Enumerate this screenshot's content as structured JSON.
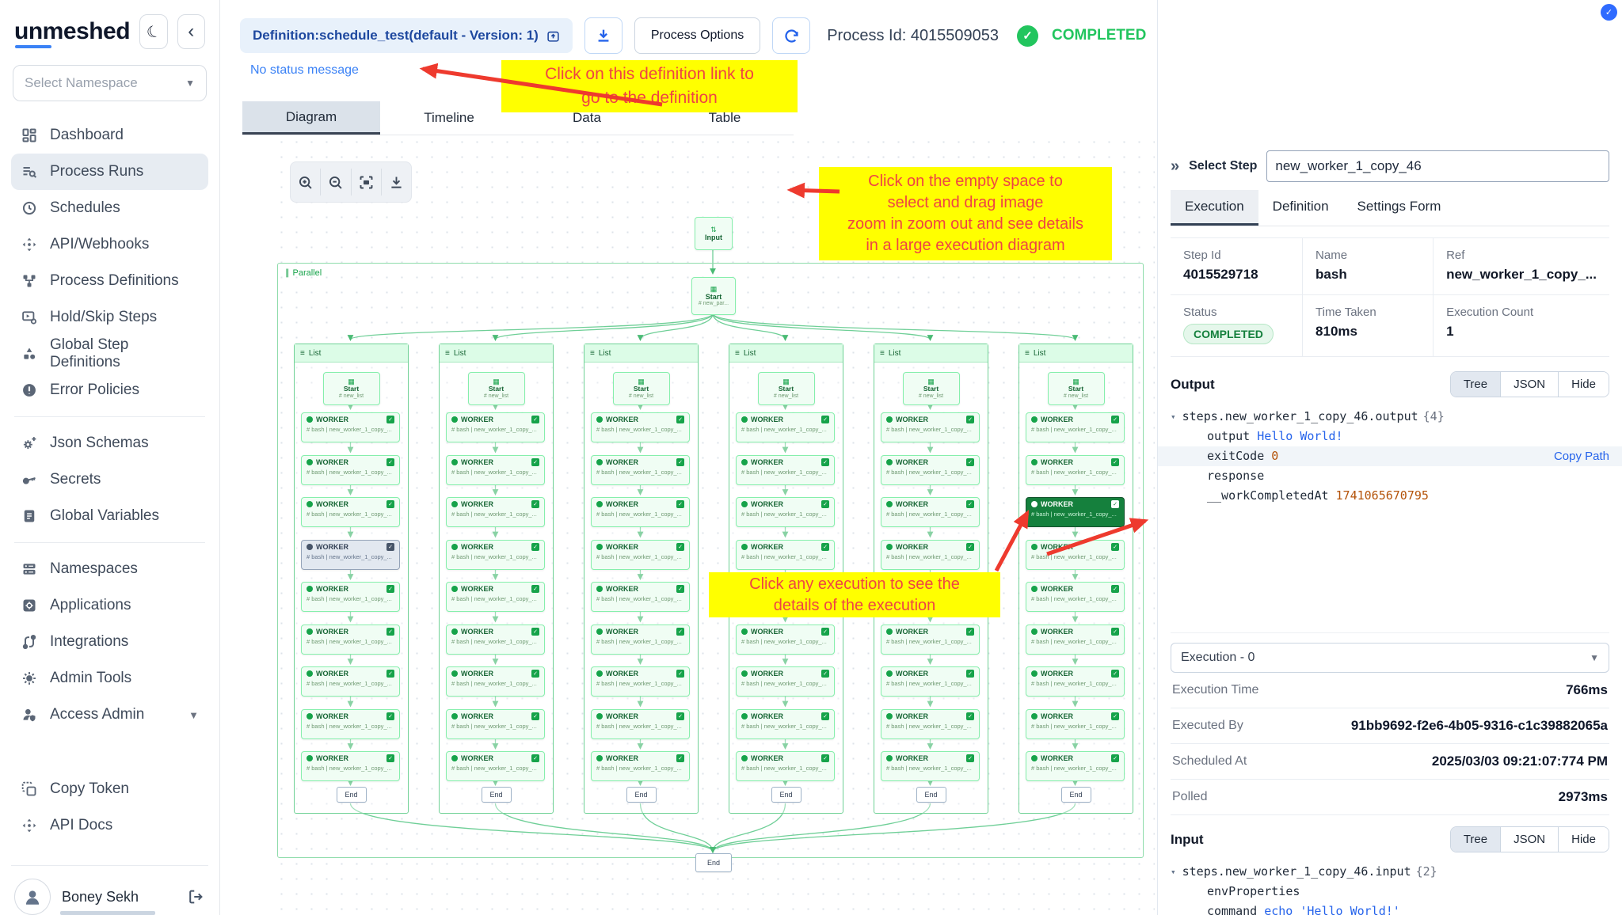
{
  "app": {
    "logo": "unmeshed"
  },
  "sidebar": {
    "namespace_placeholder": "Select Namespace",
    "items": [
      {
        "label": "Dashboard"
      },
      {
        "label": "Process Runs"
      },
      {
        "label": "Schedules"
      },
      {
        "label": "API/Webhooks"
      },
      {
        "label": "Process Definitions"
      },
      {
        "label": "Hold/Skip Steps"
      },
      {
        "label": "Global Step Definitions"
      },
      {
        "label": "Error Policies"
      },
      {
        "label": "Json Schemas"
      },
      {
        "label": "Secrets"
      },
      {
        "label": "Global Variables"
      },
      {
        "label": "Namespaces"
      },
      {
        "label": "Applications"
      },
      {
        "label": "Integrations"
      },
      {
        "label": "Admin Tools"
      },
      {
        "label": "Access Admin"
      },
      {
        "label": "Copy Token"
      },
      {
        "label": "API Docs"
      }
    ],
    "user": {
      "name": "Boney Sekh"
    }
  },
  "header": {
    "definition_link": "Definition:schedule_test(default - Version: 1)",
    "process_options_label": "Process Options",
    "process_id_label": "Process Id: 4015509053",
    "status": "COMPLETED",
    "status_message": "No status message",
    "status_color": "#22c55e"
  },
  "tabs": {
    "items": [
      "Diagram",
      "Timeline",
      "Data",
      "Table"
    ],
    "active": "Diagram"
  },
  "annotations": [
    {
      "lines": [
        "Click on this definition link to",
        "go to the definition"
      ]
    },
    {
      "lines": [
        "Click on the empty space to",
        "select and drag image",
        "zoom in zoom out and see details",
        "in a large execution diagram"
      ]
    },
    {
      "lines": [
        "Click any execution to see the",
        "details of the execution"
      ]
    }
  ],
  "diagram": {
    "input_node": {
      "label": "Input"
    },
    "parallel_label": "Parallel",
    "start_node": {
      "label": "Start",
      "sub": "# new_par..."
    },
    "list_label": "List",
    "column_count": 6,
    "workers_per_column": 9,
    "column_start": {
      "label": "Start",
      "sub": "# new_list"
    },
    "worker": {
      "label": "WORKER",
      "sub": "# bash | new_worker_1_copy_..."
    },
    "end_label": "End",
    "selected": {
      "column": 5,
      "row": 2
    },
    "highlighted": {
      "column": 0,
      "row": 3
    },
    "accent_green": "#16a34a"
  },
  "panel": {
    "select_step_label": "Select Step",
    "select_step_value": "new_worker_1_copy_46",
    "tabs": [
      "Execution",
      "Definition",
      "Settings Form"
    ],
    "active_tab": "Execution",
    "info": {
      "step_id_label": "Step Id",
      "step_id": "4015529718",
      "name_label": "Name",
      "name": "bash",
      "ref_label": "Ref",
      "ref": "new_worker_1_copy_...",
      "status_label": "Status",
      "status": "COMPLETED",
      "time_taken_label": "Time Taken",
      "time_taken": "810ms",
      "execution_count_label": "Execution Count",
      "execution_count": "1"
    },
    "output": {
      "title": "Output",
      "view_options": [
        "Tree",
        "JSON",
        "Hide"
      ],
      "root": "steps.new_worker_1_copy_46.output",
      "root_count": "{4}",
      "rows": [
        {
          "key": "output",
          "value": "Hello World!"
        },
        {
          "key": "exitCode",
          "value": "0",
          "action": "Copy Path"
        },
        {
          "key": "response",
          "value": ""
        },
        {
          "key": "__workCompletedAt",
          "value": "1741065670795"
        }
      ]
    },
    "execution_select": "Execution - 0",
    "details": [
      {
        "label": "Execution Time",
        "value": "766ms"
      },
      {
        "label": "Executed By",
        "value": "91bb9692-f2e6-4b05-9316-c1c39882065a"
      },
      {
        "label": "Scheduled At",
        "value": "2025/03/03 09:21:07:774 PM"
      },
      {
        "label": "Polled",
        "value": "2973ms"
      }
    ],
    "input": {
      "title": "Input",
      "view_options": [
        "Tree",
        "JSON",
        "Hide"
      ],
      "root": "steps.new_worker_1_copy_46.input",
      "root_count": "{2}",
      "rows": [
        {
          "key": "envProperties",
          "value": ""
        },
        {
          "key": "command",
          "value": "echo 'Hello World!'"
        }
      ]
    }
  }
}
